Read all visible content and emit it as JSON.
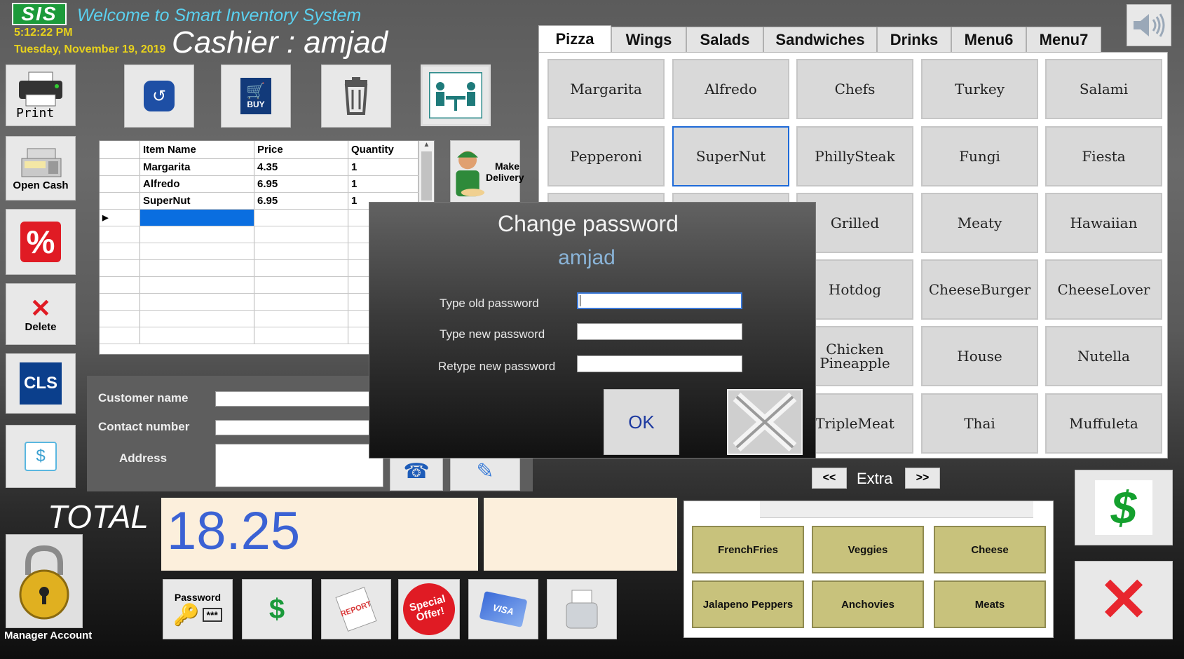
{
  "app": {
    "logo": "SIS",
    "welcome": "Welcome to Smart Inventory System",
    "time": "5:12:22 PM",
    "date": "Tuesday, November 19, 2019",
    "cashier": "Cashier : amjad"
  },
  "left_tools": {
    "print": "Print",
    "open_cash": "Open Cash",
    "delete": "Delete",
    "cls": "CLS"
  },
  "top_tools": {
    "return": "Return",
    "buy": "BUY",
    "make_delivery": "Make Delivery"
  },
  "order_grid": {
    "headers": [
      "Item Name",
      "Price",
      "Quantity"
    ],
    "rows": [
      {
        "name": "Margarita",
        "price": "4.35",
        "qty": "1"
      },
      {
        "name": "Alfredo",
        "price": "6.95",
        "qty": "1"
      },
      {
        "name": "SuperNut",
        "price": "6.95",
        "qty": "1"
      }
    ]
  },
  "customer": {
    "name_label": "Customer name",
    "contact_label": "Contact number",
    "address_label": "Address"
  },
  "total": {
    "label": "TOTAL",
    "value": "18.25"
  },
  "manager": {
    "label": "Manager Account"
  },
  "bottom_tools": {
    "password": "Password",
    "password_mask": "***",
    "report": "REPORT",
    "special": "Special Offer!",
    "visa": "VISA"
  },
  "categories": {
    "tabs": [
      "Pizza",
      "Wings",
      "Salads",
      "Sandwiches",
      "Drinks",
      "Menu6",
      "Menu7"
    ],
    "active": "Pizza",
    "items": [
      "Margarita",
      "Alfredo",
      "Chefs",
      "Turkey",
      "Salami",
      "Pepperoni",
      "SuperNut",
      "PhillySteak",
      "Fungi",
      "Fiesta",
      "",
      "",
      "Grilled",
      "Meaty",
      "Hawaiian",
      "",
      "",
      "Hotdog",
      "CheeseBurger",
      "CheeseLover",
      "",
      "",
      "Chicken Pineapple",
      "House",
      "Nutella",
      "",
      "",
      "TripleMeat",
      "Thai",
      "Muffuleta"
    ]
  },
  "extra": {
    "prev": "<<",
    "label": "Extra",
    "next": ">>",
    "items": [
      "FrenchFries",
      "Veggies",
      "Cheese",
      "Jalapeno Peppers",
      "Anchovies",
      "Meats"
    ]
  },
  "dialog": {
    "title": "Change password",
    "user": "amjad",
    "old_label": "Type old password",
    "new_label": "Type new password",
    "retype_label": "Retype new password",
    "ok": "OK"
  },
  "colors": {
    "logo_green": "#1c9a3a",
    "accent_blue": "#3b62d4",
    "total_bg": "#fcefdc",
    "extra_olive": "#c8c27c",
    "date_yellow": "#e8d21c"
  }
}
